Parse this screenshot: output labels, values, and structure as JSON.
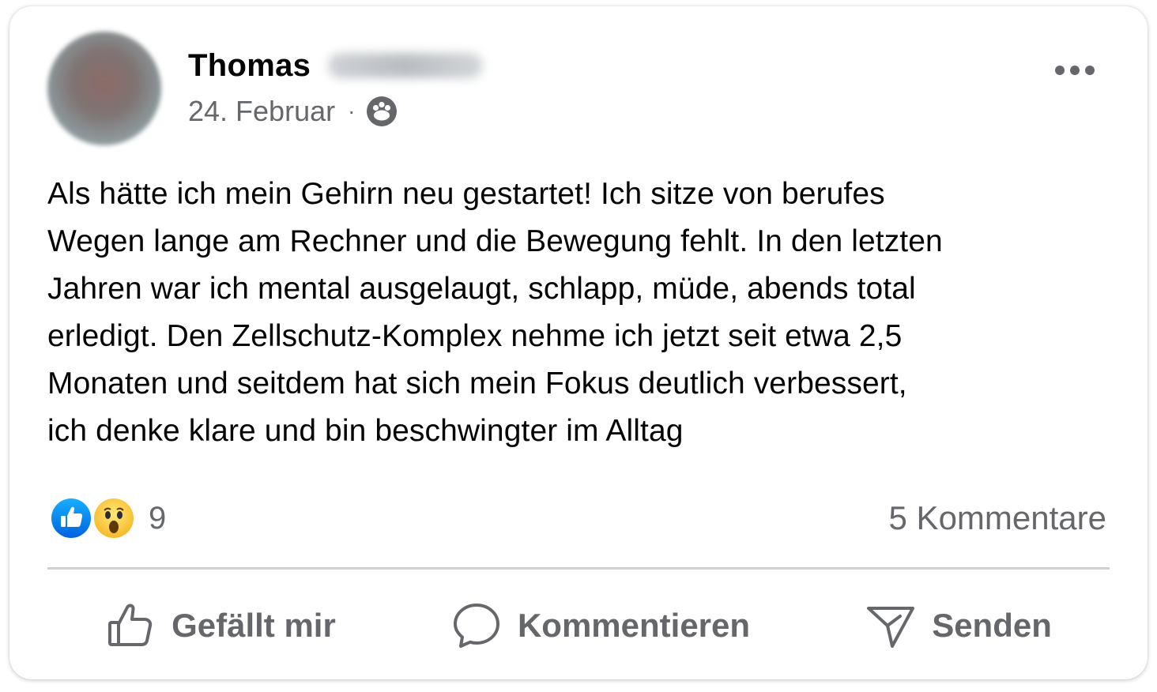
{
  "post": {
    "author_first_name": "Thomas",
    "date": "24. Februar",
    "meta_separator": "·",
    "audience_icon": "friends-icon",
    "body": "Als hätte ich mein Gehirn neu gestartet! Ich sitze von berufes\nWegen lange am Rechner und die Bewegung fehlt. In den letzten\nJahren war ich mental ausgelaugt, schlapp, müde, abends total\nerledigt. Den Zellschutz-Komplex nehme ich jetzt seit etwa 2,5\nMonaten und seitdem hat sich mein Fokus deutlich verbessert,\nich denke klare und bin beschwingter im Alltag"
  },
  "reactions": {
    "types": [
      "like",
      "wow"
    ],
    "count": "9"
  },
  "comments": {
    "label": "5 Kommentare"
  },
  "actions": {
    "like_label": "Gefällt mir",
    "comment_label": "Kommentieren",
    "share_label": "Senden"
  },
  "colors": {
    "text_primary": "#050505",
    "text_secondary": "#65676b",
    "like_blue": "#1877f2",
    "wow_yellow": "#f7b928",
    "divider": "#ced0d4"
  }
}
